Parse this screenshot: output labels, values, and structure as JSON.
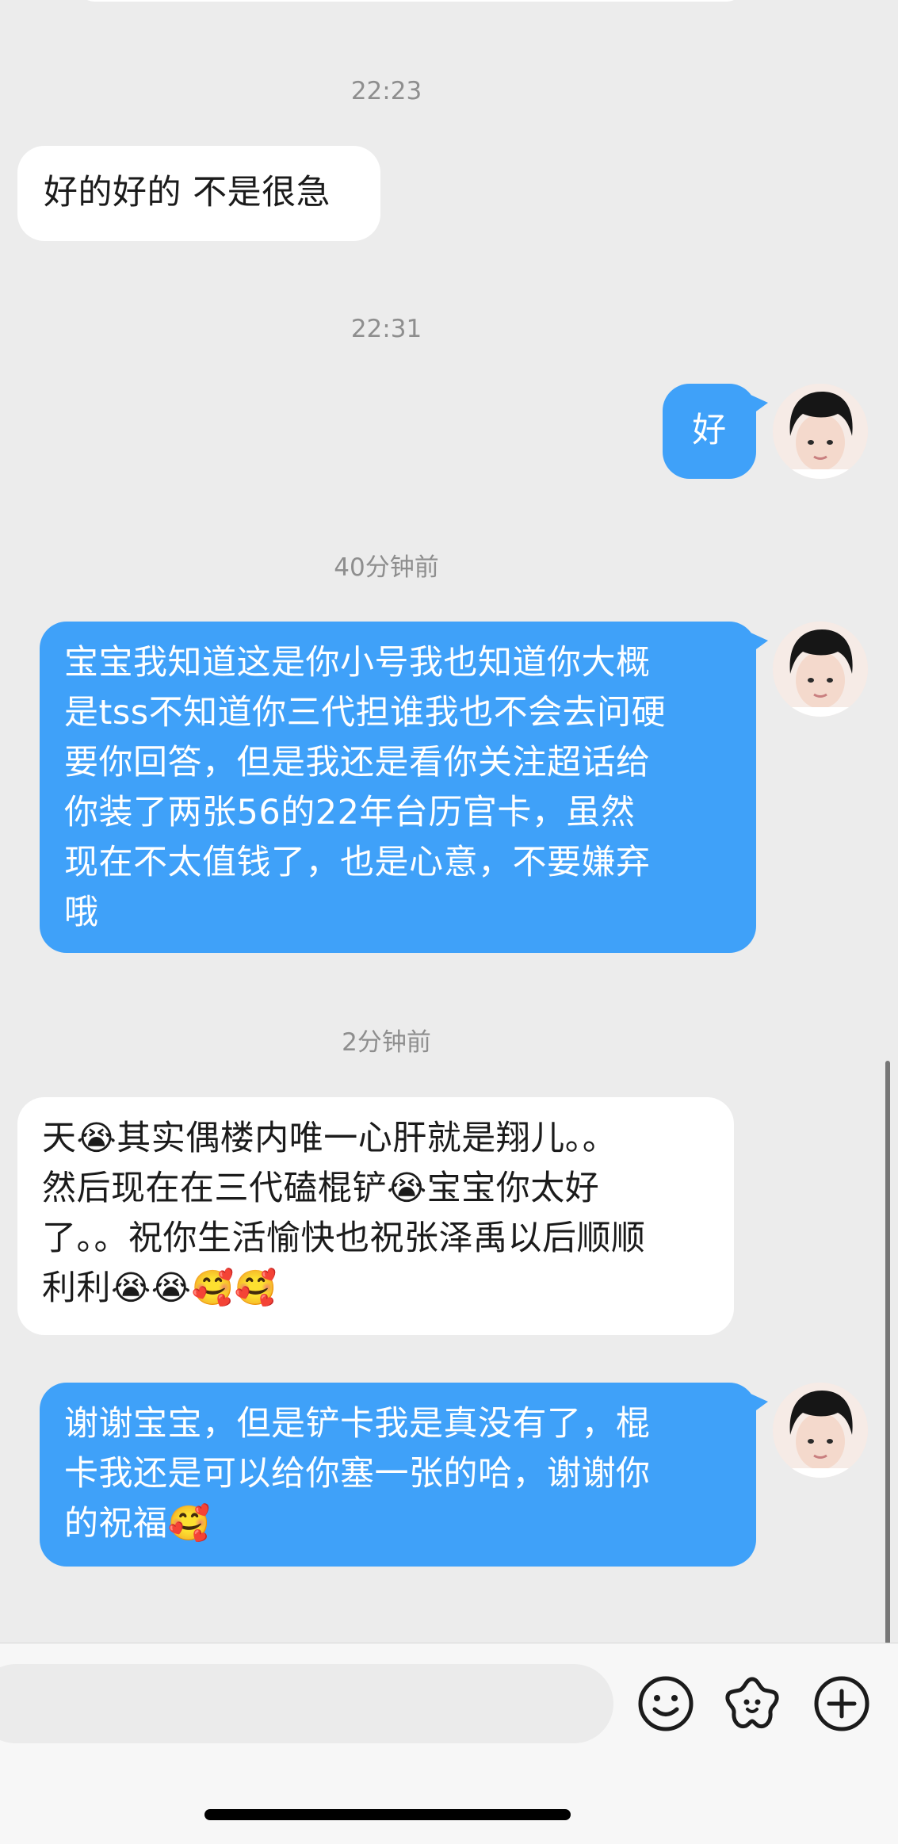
{
  "messages": [
    {
      "type": "time",
      "text": "22:23"
    },
    {
      "type": "incoming",
      "text": "好的好的 不是很急"
    },
    {
      "type": "time",
      "text": "22:31"
    },
    {
      "type": "outgoing",
      "text": "好"
    },
    {
      "type": "time",
      "text": "40分钟前"
    },
    {
      "type": "outgoing",
      "lines": [
        "宝宝我知道这是你小号我也知道你大概",
        "是tss不知道你三代担谁我也不会去问硬",
        "要你回答，但是我还是看你关注超话给",
        "你装了两张56的22年台历官卡，虽然",
        "现在不太值钱了，也是心意，不要嫌弃",
        "哦"
      ]
    },
    {
      "type": "time",
      "text": "2分钟前"
    },
    {
      "type": "incoming",
      "lines": [
        "天😭其实偶楼内唯一心肝就是翔儿。。",
        "然后现在在三代磕棍铲😭宝宝你太好",
        "了。。祝你生活愉快也祝张泽禹以后顺顺",
        "利利😭😭🥰🥰"
      ]
    },
    {
      "type": "outgoing",
      "lines": [
        "谢谢宝宝，但是铲卡我是真没有了，棍",
        "卡我还是可以给你塞一张的哈，谢谢你",
        "的祝福🥰"
      ]
    }
  ],
  "input": {
    "placeholder": ""
  },
  "toolbar": {
    "icons": [
      "emoji-icon",
      "sticker-icon",
      "add-icon"
    ]
  },
  "colors": {
    "outgoing_bubble": "#3fa1f9",
    "incoming_bubble": "#ffffff",
    "background": "#ececec"
  }
}
